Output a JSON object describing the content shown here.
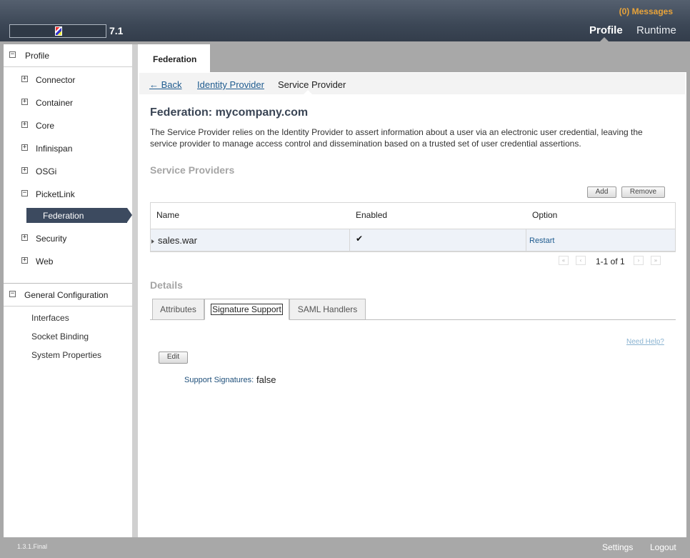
{
  "header": {
    "version": "7.1",
    "messages": "(0) Messages",
    "tabs": [
      {
        "label": "Profile"
      },
      {
        "label": "Runtime"
      }
    ]
  },
  "sidebar": {
    "profile_header": {
      "label": "Profile",
      "toggle": "−"
    },
    "tree": [
      {
        "label": "Connector",
        "toggle": "+"
      },
      {
        "label": "Container",
        "toggle": "+"
      },
      {
        "label": "Core",
        "toggle": "+"
      },
      {
        "label": "Infinispan",
        "toggle": "+"
      },
      {
        "label": "OSGi",
        "toggle": "+"
      },
      {
        "label": "PicketLink",
        "toggle": "−"
      },
      {
        "label": "Federation"
      },
      {
        "label": "Security",
        "toggle": "+"
      },
      {
        "label": "Web",
        "toggle": "+"
      }
    ],
    "general_header": {
      "label": "General Configuration",
      "toggle": "−"
    },
    "general_items": [
      {
        "label": "Interfaces"
      },
      {
        "label": "Socket Binding"
      },
      {
        "label": "System Properties"
      }
    ]
  },
  "main": {
    "tab": "Federation",
    "breadcrumb": {
      "back": "← Back",
      "idp": "Identity Provider",
      "current": "Service Provider"
    },
    "title": "Federation: mycompany.com",
    "description": "The Service Provider relies on the Identity Provider to assert information about a user via an electronic user credential, leaving the service provider to manage access control and dissemination based on a trusted set of user credential assertions.",
    "sp_heading": "Service Providers",
    "buttons": {
      "add": "Add",
      "remove": "Remove"
    },
    "table": {
      "columns": [
        "Name",
        "Enabled",
        "Option"
      ],
      "rows": [
        {
          "name": "sales.war",
          "enabled": "✔",
          "option": "Restart"
        }
      ]
    },
    "pager": {
      "first": "«",
      "prev": "‹",
      "text": "1-1 of 1",
      "next": "›",
      "last": "»"
    },
    "details_heading": "Details",
    "detail_tabs": [
      "Attributes",
      "Signature Support",
      "SAML Handlers"
    ],
    "need_help": "Need Help?",
    "edit": "Edit",
    "support_signatures": {
      "label": "Support Signatures:",
      "value": "false"
    }
  },
  "footer": {
    "version": "1.3.1.Final",
    "settings": "Settings",
    "logout": "Logout"
  },
  "colors": {
    "header": "#3c4756",
    "accent": "#e8a33a",
    "selected_nav": "#3c4a5f",
    "link": "#1e5b8f"
  }
}
